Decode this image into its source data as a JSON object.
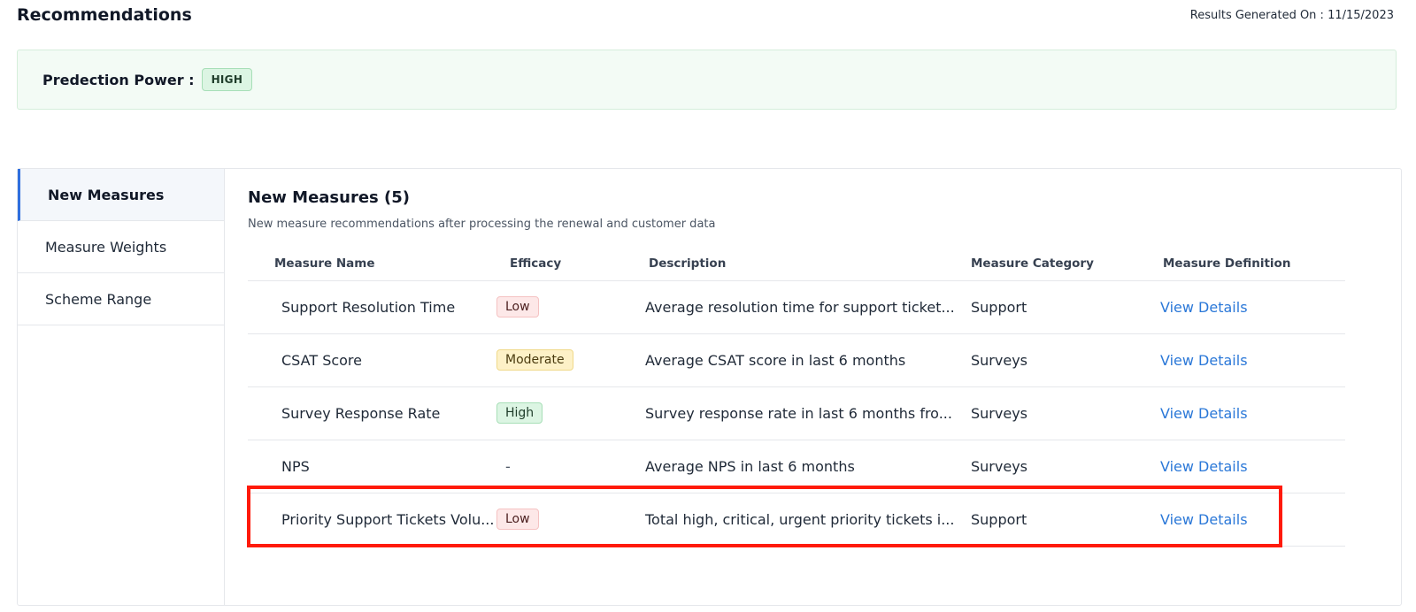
{
  "header": {
    "title": "Recommendations",
    "generated_label": "Results Generated On : 11/15/2023"
  },
  "prediction": {
    "label": "Predection Power :",
    "badge": "HIGH"
  },
  "sidebar": {
    "items": [
      {
        "label": "New Measures",
        "active": true
      },
      {
        "label": "Measure Weights",
        "active": false
      },
      {
        "label": "Scheme Range",
        "active": false
      }
    ]
  },
  "main": {
    "title": "New Measures (5)",
    "subtitle": "New measure recommendations after processing the renewal and customer data",
    "columns": [
      "Measure Name",
      "Efficacy",
      "Description",
      "Measure Category",
      "Measure Definition"
    ],
    "rows": [
      {
        "name": "Support Resolution Time",
        "efficacy": "Low",
        "efficacy_level": "low",
        "description": "Average resolution time for support ticket...",
        "category": "Support",
        "link": "View Details"
      },
      {
        "name": "CSAT Score",
        "efficacy": "Moderate",
        "efficacy_level": "moderate",
        "description": "Average CSAT score in last 6 months",
        "category": "Surveys",
        "link": "View Details"
      },
      {
        "name": "Survey Response Rate",
        "efficacy": "High",
        "efficacy_level": "high",
        "description": "Survey response rate in last 6 months fro...",
        "category": "Surveys",
        "link": "View Details"
      },
      {
        "name": "NPS",
        "efficacy": "-",
        "efficacy_level": "none",
        "description": "Average NPS in last 6 months",
        "category": "Surveys",
        "link": "View Details"
      },
      {
        "name": "Priority Support Tickets Volu...",
        "efficacy": "Low",
        "efficacy_level": "low",
        "description": "Total high, critical, urgent priority tickets i...",
        "category": "Support",
        "link": "View Details",
        "highlighted": true
      }
    ]
  },
  "colors": {
    "accent": "#2f6fde",
    "link": "#2b78d8",
    "highlight": "#ff1a0a"
  }
}
